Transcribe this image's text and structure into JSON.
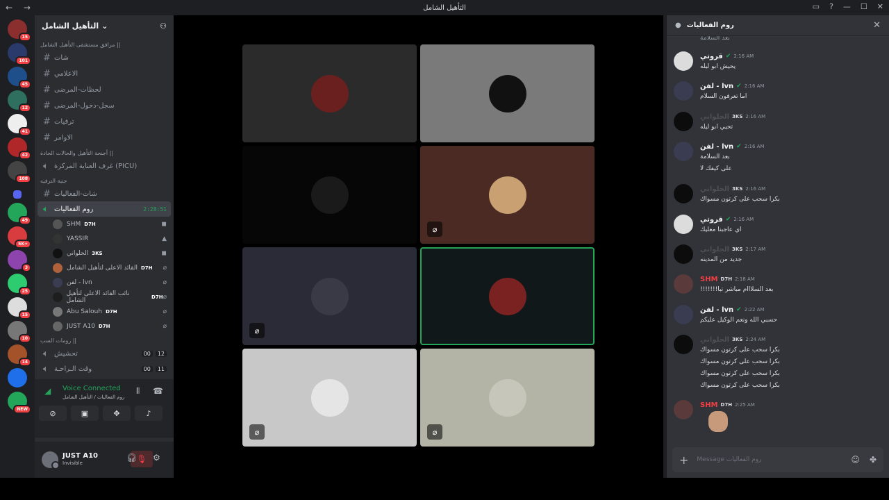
{
  "window": {
    "title": "التأهيل الشامل"
  },
  "servers": [
    {
      "badge": "15",
      "color": "#8b2e2e"
    },
    {
      "badge": "101",
      "color": "#2a3a6a"
    },
    {
      "badge": "45",
      "color": "#1f4f8a"
    },
    {
      "badge": "12",
      "color": "#2f6f5f"
    },
    {
      "badge": "41",
      "color": "#eeeeee"
    },
    {
      "badge": "42",
      "color": "#b0272a"
    },
    {
      "badge": "108",
      "color": "#444444"
    },
    {
      "badge": "",
      "color": "#5865f2"
    },
    {
      "badge": "49",
      "color": "#23a55a"
    },
    {
      "badge": "5K+",
      "color": "#d83c3e"
    },
    {
      "badge": "3",
      "color": "#8e44ad"
    },
    {
      "badge": "25",
      "color": "#2ecc71"
    },
    {
      "badge": "15",
      "color": "#dddddd"
    },
    {
      "badge": "10",
      "color": "#777777"
    },
    {
      "badge": "14",
      "color": "#a3522a"
    },
    {
      "badge": "",
      "color": "#1f6feb"
    },
    {
      "badge": "NEW",
      "color": "#23a55a"
    }
  ],
  "guild": {
    "name": "التأهيل الشامل"
  },
  "categories": {
    "c1": "مرافق مستشفى التأهيل الشامل ||",
    "c2": "أجنحة التأهيل والحالات الحادة ||",
    "c3": "جنية الترفيه",
    "c4": "رومات السب ||"
  },
  "text_channels": [
    "شات",
    "الاعلامي",
    "لحظات-المرضى",
    "سجل-دخول-المرضى",
    "ترقيات",
    "الاوامر"
  ],
  "picu": "غرف العناية المركزة (PICU)",
  "fun_channel": "شات-الفعاليات",
  "voice_channel": {
    "name": "روم الفعاليات",
    "timer": "2:28:51"
  },
  "voice_users": [
    {
      "name": "SHM",
      "tag": "D7H",
      "icon": "◼"
    },
    {
      "name": "YASSIR",
      "tag": "",
      "icon": "▲"
    },
    {
      "name": "الحلواني",
      "tag": "3KS",
      "icon": "◼"
    },
    {
      "name": "القائد الاعلى لتأهيل الشامل",
      "tag": "D7H",
      "icon": "⌀"
    },
    {
      "name": "لفن - lvn",
      "tag": "",
      "icon": "⌀"
    },
    {
      "name": "نائب القائد الاعلى لتأهيل الشامل",
      "tag": "D7H",
      "icon": "⌀"
    },
    {
      "name": "Abu Salouh",
      "tag": "D7H",
      "icon": "⌀"
    },
    {
      "name": "JUST A10",
      "tag": "D7H",
      "icon": "⌀"
    }
  ],
  "other_voice": [
    {
      "name": "تحشيش",
      "c1": "00",
      "c2": "12"
    },
    {
      "name": "وقت الـراحـة",
      "c1": "00",
      "c2": "11"
    }
  ],
  "voice_status": {
    "title": "Voice Connected",
    "sub": "روم الفعاليات / التأهيل الشامل"
  },
  "user": {
    "name": "JUST A10",
    "status": "Invisible"
  },
  "tiles": [
    {
      "bg": "#2b2b2b",
      "av": "#6b2020",
      "muted": false
    },
    {
      "bg": "#7a7a7a",
      "av": "#111111",
      "muted": false
    },
    {
      "bg": "#060606",
      "av": "#1a1a1a",
      "muted": false
    },
    {
      "bg": "#4a2a22",
      "av": "#c9a072",
      "muted": true
    },
    {
      "bg": "#2b2b37",
      "av": "#3a3a46",
      "muted": true
    },
    {
      "bg": "#10181a",
      "av": "#7a2222",
      "muted": false,
      "speaking": true
    },
    {
      "bg": "#c8c8c8",
      "av": "#e5e5e5",
      "muted": true
    },
    {
      "bg": "#b3b3a6",
      "av": "#c6c6bb",
      "muted": true
    }
  ],
  "chat": {
    "title": "روم الفعاليات",
    "top_line": "بعد السلامة",
    "placeholder": "Message روم الفعاليات",
    "messages": [
      {
        "name": "قروتي",
        "color": "#f2f3f5",
        "tag": "",
        "time": "2:16 AM",
        "av": "#dcdcdc",
        "lines": [
          "يحيش ابو ليله"
        ]
      },
      {
        "name": "لفن - lvn",
        "color": "#f2f3f5",
        "tag": "",
        "time": "2:16 AM",
        "av": "#3a3d52",
        "lines": [
          "اما تعرفون السلام"
        ]
      },
      {
        "name": "الحلواني",
        "color": "#4e5058",
        "tag": "3KS",
        "time": "2:16 AM",
        "av": "#0c0c0c",
        "lines": [
          "تحيي ابو ليله"
        ]
      },
      {
        "name": "لفن - lvn",
        "color": "#f2f3f5",
        "tag": "",
        "time": "2:16 AM",
        "av": "#3a3d52",
        "lines": [
          "بعد السلامة",
          "على كيفك لا"
        ]
      },
      {
        "name": "الحلواني",
        "color": "#4e5058",
        "tag": "3KS",
        "time": "2:16 AM",
        "av": "#0c0c0c",
        "lines": [
          "بكرا سحب على كرتون مسواك"
        ]
      },
      {
        "name": "قروتي",
        "color": "#f2f3f5",
        "tag": "",
        "time": "2:16 AM",
        "av": "#dcdcdc",
        "lines": [
          "اي عاجبنا معليك"
        ]
      },
      {
        "name": "الحلواني",
        "color": "#4e5058",
        "tag": "3KS",
        "time": "2:17 AM",
        "av": "#0c0c0c",
        "lines": [
          "جديد من المدينه"
        ]
      },
      {
        "name": "SHM",
        "color": "#f23f43",
        "tag": "D7H",
        "time": "2:18 AM",
        "av": "#5a3a3a",
        "lines": [
          "بعد السلااام مباشر تبا!!!!!!!"
        ]
      },
      {
        "name": "لفن - lvn",
        "color": "#f2f3f5",
        "tag": "",
        "time": "2:22 AM",
        "av": "#3a3d52",
        "lines": [
          "حسبي الله ونعم الوكيل عليكم"
        ]
      },
      {
        "name": "الحلواني",
        "color": "#4e5058",
        "tag": "3KS",
        "time": "2:24 AM",
        "av": "#0c0c0c",
        "lines": [
          "بكرا سحب على كرتون مسواك",
          "بكرا سحب على كرتون مسواك",
          "بكرا سحب على كرتون مسواك",
          "بكرا سحب على كرتون مسواك"
        ]
      },
      {
        "name": "SHM",
        "color": "#f23f43",
        "tag": "D7H",
        "time": "2:25 AM",
        "av": "#5a3a3a",
        "lines": [
          ""
        ]
      }
    ]
  }
}
